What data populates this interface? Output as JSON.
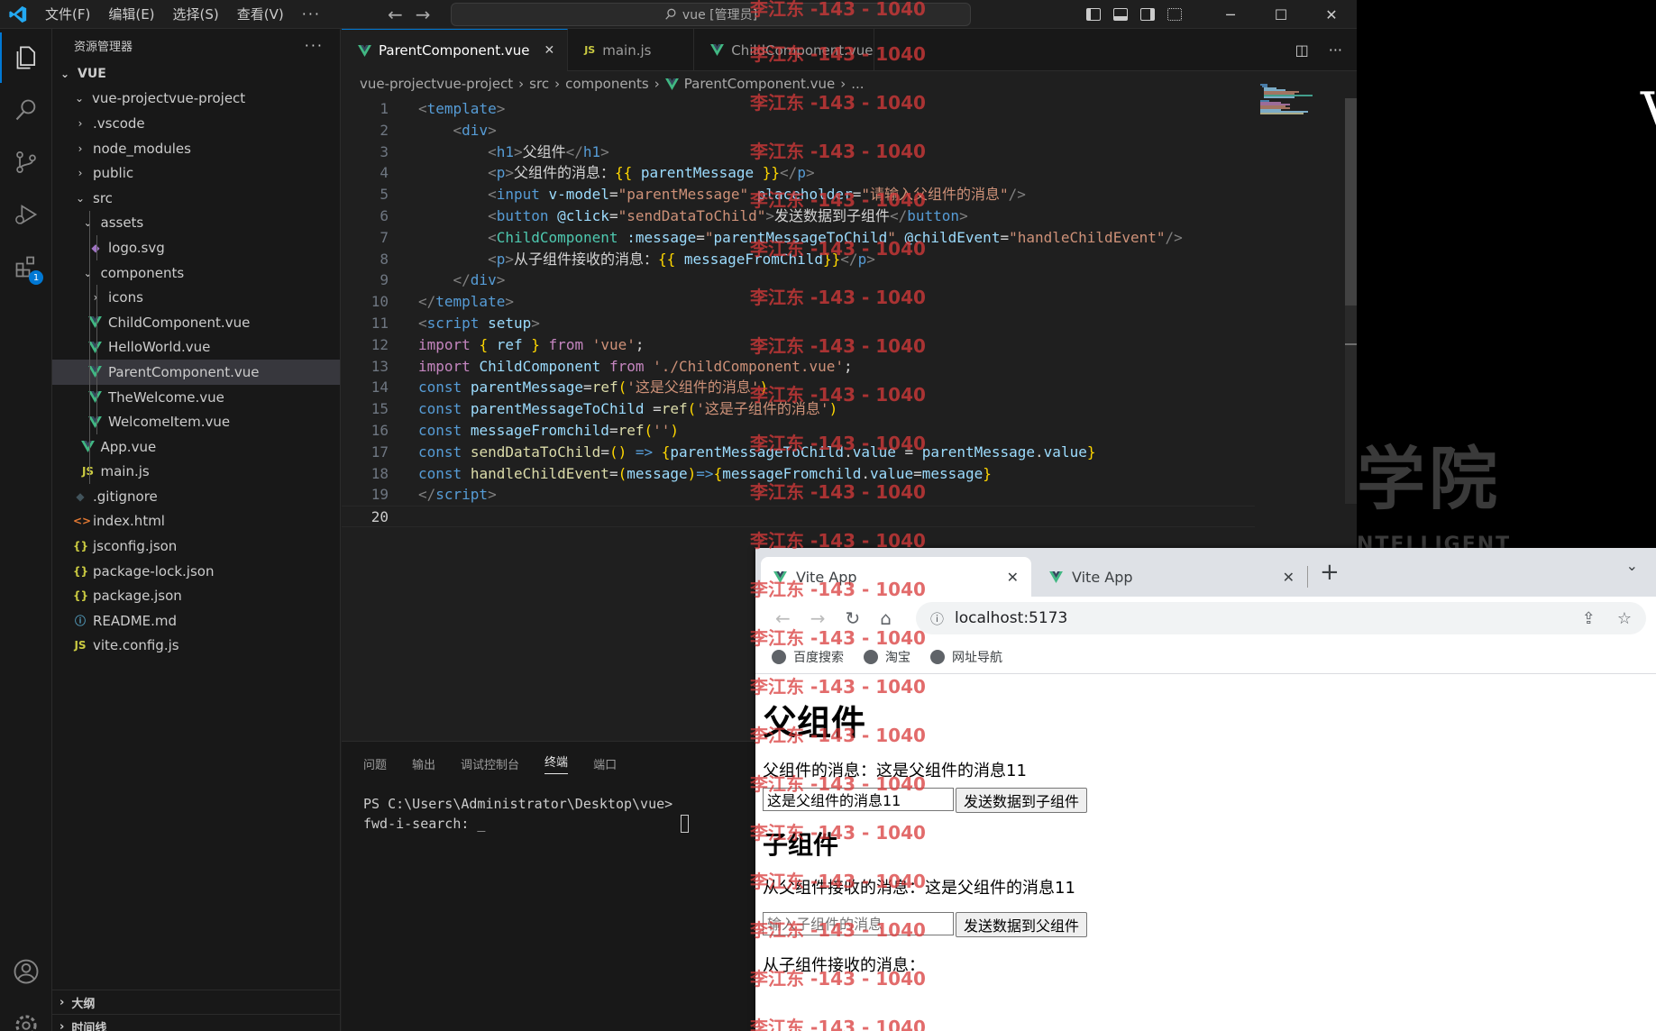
{
  "vscode": {
    "menu": [
      "文件(F)",
      "编辑(E)",
      "选择(S)",
      "查看(V)"
    ],
    "menu_more": "···",
    "command_center": "vue [管理员]",
    "activity_badge": "1",
    "explorer": {
      "title": "资源管理器",
      "more": "···",
      "root": "VUE",
      "project": "vue-projectvue-project",
      "items": [
        {
          "label": ".vscode",
          "type": "folder"
        },
        {
          "label": "node_modules",
          "type": "folder"
        },
        {
          "label": "public",
          "type": "folder"
        },
        {
          "label": "src",
          "type": "folder-open"
        },
        {
          "label": "assets",
          "type": "folder-open"
        },
        {
          "label": "logo.svg",
          "type": "svg"
        },
        {
          "label": "components",
          "type": "folder-open"
        },
        {
          "label": "icons",
          "type": "folder"
        },
        {
          "label": "ChildComponent.vue",
          "type": "vue"
        },
        {
          "label": "HelloWorld.vue",
          "type": "vue"
        },
        {
          "label": "ParentComponent.vue",
          "type": "vue",
          "selected": true
        },
        {
          "label": "TheWelcome.vue",
          "type": "vue"
        },
        {
          "label": "WelcomeItem.vue",
          "type": "vue"
        },
        {
          "label": "App.vue",
          "type": "vue"
        },
        {
          "label": "main.js",
          "type": "js"
        },
        {
          "label": ".gitignore",
          "type": "git"
        },
        {
          "label": "index.html",
          "type": "html"
        },
        {
          "label": "jsconfig.json",
          "type": "json"
        },
        {
          "label": "package-lock.json",
          "type": "json"
        },
        {
          "label": "package.json",
          "type": "json"
        },
        {
          "label": "README.md",
          "type": "md"
        },
        {
          "label": "vite.config.js",
          "type": "js"
        }
      ],
      "outline": "大纲",
      "timeline": "时间线"
    },
    "tabs": [
      {
        "label": "ParentComponent.vue",
        "icon": "vue",
        "active": true
      },
      {
        "label": "main.js",
        "icon": "js"
      },
      {
        "label": "ChildComponent.vue",
        "icon": "vue"
      }
    ],
    "breadcrumb": [
      "vue-projectvue-project",
      "src",
      "components",
      "ParentComponent.vue",
      "..."
    ],
    "panel": {
      "tabs": [
        "问题",
        "输出",
        "调试控制台",
        "终端",
        "端口"
      ],
      "active_tab": "终端",
      "terminal": [
        "PS C:\\Users\\Administrator\\Desktop\\vue>",
        "fwd-i-search: _"
      ]
    }
  },
  "desktop": {
    "bg_letter": "V",
    "bg_cn": "学院",
    "bg_en": "NTELLIGENT"
  },
  "browser": {
    "tabs": [
      "Vite App",
      "Vite App"
    ],
    "url": "localhost:5173",
    "bookmarks": [
      "百度搜索",
      "淘宝",
      "网址导航"
    ],
    "page": {
      "h1": "父组件",
      "parent_msg": "父组件的消息：这是父组件的消息11",
      "input_value": "这是父组件的消息11",
      "send_child_btn": "发送数据到子组件",
      "h2": "子组件",
      "child_msg": "从父组件接收的消息：这是父组件的消息11",
      "child_input_placeholder": "输入子组件的消息",
      "send_parent_btn": "发送数据到父组件",
      "from_child": "从子组件接收的消息："
    }
  },
  "watermark": "李江东 -143 - 1040"
}
